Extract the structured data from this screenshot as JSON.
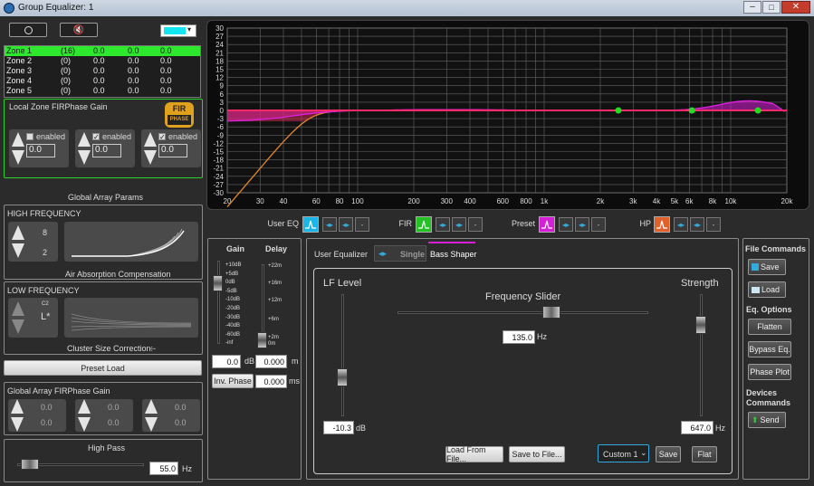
{
  "window": {
    "title": "Group Equalizer: 1"
  },
  "zones": [
    {
      "name": "Zone 1",
      "count": "(16)",
      "v1": "0.0",
      "v2": "0.0",
      "v3": "0.0"
    },
    {
      "name": "Zone 2",
      "count": "(0)",
      "v1": "0.0",
      "v2": "0.0",
      "v3": "0.0"
    },
    {
      "name": "Zone 3",
      "count": "(0)",
      "v1": "0.0",
      "v2": "0.0",
      "v3": "0.0"
    },
    {
      "name": "Zone 4",
      "count": "(0)",
      "v1": "0.0",
      "v2": "0.0",
      "v3": "0.0"
    },
    {
      "name": "Zone 5",
      "count": "(0)",
      "v1": "0.0",
      "v2": "0.0",
      "v3": "0.0"
    }
  ],
  "local_fir": {
    "title": "Local Zone FIRPhase Gain",
    "logo_top": "FIR",
    "logo_bottom": "PHASE",
    "channels": [
      {
        "label": "enabled",
        "value": "0.0",
        "checked": false
      },
      {
        "label": "enabled",
        "value": "0.0",
        "checked": true
      },
      {
        "label": "enabled",
        "value": "0.0",
        "checked": true
      }
    ]
  },
  "global_params": {
    "title": "Global Array Params"
  },
  "high_freq": {
    "title": "HIGH FREQUENCY",
    "top": "8",
    "bottom": "2",
    "caption": "Air Absorption Compensation"
  },
  "low_freq": {
    "title": "LOW FREQUENCY",
    "sup": "C2",
    "value": "L*",
    "caption": "Cluster Size Correction:",
    "caption_value": "--"
  },
  "preset_load": "Preset Load",
  "global_fir": {
    "title": "Global Array FIRPhase Gain",
    "values": [
      "0.0",
      "0.0",
      "0.0",
      "0.0",
      "0.0",
      "0.0"
    ]
  },
  "high_pass": {
    "title": "High Pass",
    "value": "55.0",
    "unit": "Hz"
  },
  "graph": {
    "y_ticks": [
      "30",
      "27",
      "24",
      "21",
      "18",
      "15",
      "12",
      "9",
      "6",
      "3",
      "0",
      "-3",
      "-6",
      "-9",
      "-12",
      "-15",
      "-18",
      "-21",
      "-24",
      "-27",
      "-30"
    ],
    "x_ticks": [
      "20",
      "30",
      "40",
      "60",
      "80",
      "100",
      "200",
      "300",
      "400",
      "600",
      "800",
      "1k",
      "2k",
      "3k",
      "4k",
      "5k",
      "6k",
      "8k",
      "10k",
      "20k"
    ]
  },
  "eq_selectors": [
    {
      "label": "User EQ",
      "color": "#1bb6e8"
    },
    {
      "label": "FIR",
      "color": "#22c322"
    },
    {
      "label": "Preset",
      "color": "#d81fd8"
    },
    {
      "label": "HP",
      "color": "#e0622a"
    }
  ],
  "gain_delay": {
    "gain_title": "Gain",
    "delay_title": "Delay",
    "gain_scale": [
      "+10dB",
      "+5dB",
      "0dB",
      "-5dB",
      "-10dB",
      "-20dB",
      "-30dB",
      "-40dB",
      "-60dB",
      "-inf"
    ],
    "delay_scale": [
      "+22m",
      "+16m",
      "+12m",
      "+6m",
      "+2m",
      "0m"
    ],
    "gain_value": "0.0",
    "gain_unit": "dB",
    "delay_m_value": "0.000",
    "delay_m_unit": "m",
    "delay_ms_value": "0.000",
    "delay_ms_unit": "ms",
    "inv_phase": "Inv. Phase"
  },
  "user_eq": {
    "title": "User Equalizer",
    "tab_single": "Single",
    "tab_bass": "Bass Shaper",
    "lf_level": "LF Level",
    "freq_slider": "Frequency Slider",
    "strength": "Strength",
    "lf_value": "-10.3",
    "lf_unit": "dB",
    "freq_value": "135.0",
    "freq_unit": "Hz",
    "strength_value": "647.0",
    "strength_unit": "Hz",
    "load_file": "Load From File...",
    "save_file": "Save to File...",
    "preset_select": "Custom 1",
    "save": "Save",
    "flat": "Flat"
  },
  "file_commands": {
    "title": "File Commands",
    "save": "Save",
    "load": "Load",
    "eq_title": "Eq. Options",
    "flatten": "Flatten",
    "bypass": "Bypass Eq.",
    "phase_plot": "Phase Plot",
    "devices_title": "Devices Commands",
    "send": "Send"
  },
  "colors": {
    "zone_highlight": "#2ee82e",
    "fir_border": "#2ed12e",
    "accent_cyan": "#1bb6e8"
  }
}
